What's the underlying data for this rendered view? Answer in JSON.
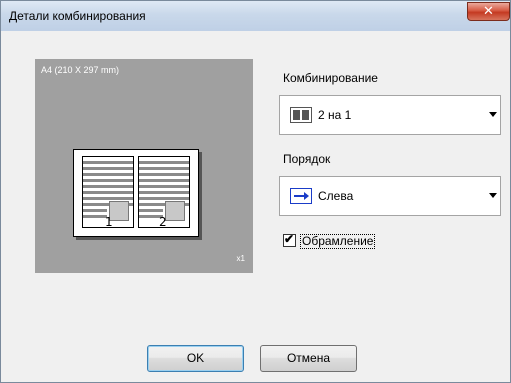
{
  "window": {
    "title": "Детали комбинирования"
  },
  "preview": {
    "paper_size": "A4  (210 X 297 mm)",
    "copies": "x1",
    "page_numbers": [
      "1",
      "2"
    ]
  },
  "combine": {
    "label": "Комбинирование",
    "value": "2 на 1",
    "icon": "two-pages-icon"
  },
  "order": {
    "label": "Порядок",
    "value": "Слева",
    "icon": "right-arrow-icon"
  },
  "border": {
    "label": "Обрамление",
    "checked": true,
    "check_glyph": "✔"
  },
  "buttons": {
    "ok": "OK",
    "cancel": "Отмена"
  },
  "close_glyph": "✕"
}
